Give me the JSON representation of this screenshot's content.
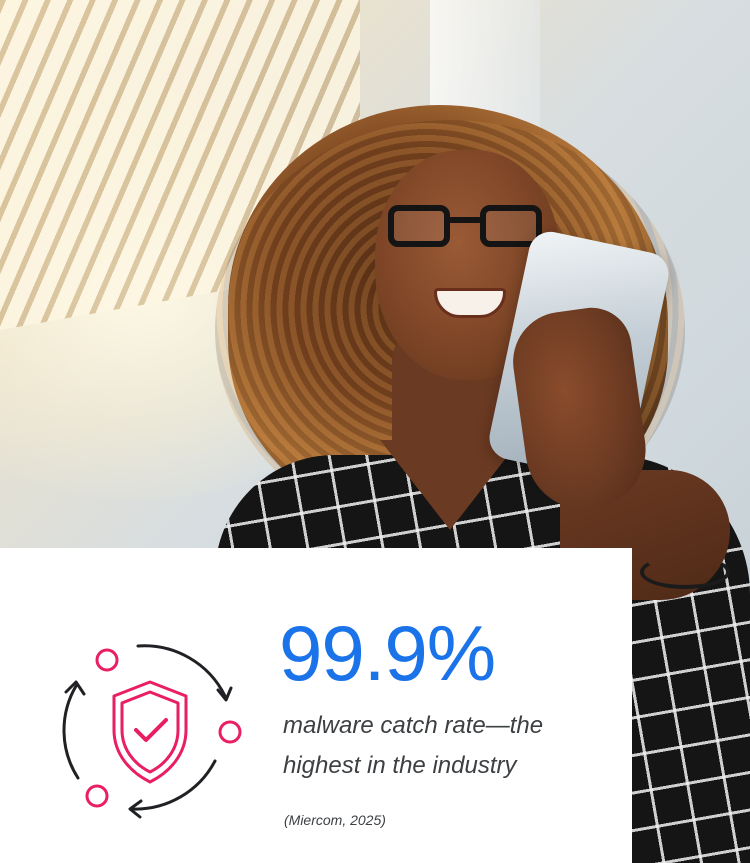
{
  "hero": {
    "image": "Smiling woman with curly hair and glasses looking at a smartphone"
  },
  "stat": {
    "value": "99.9%",
    "description": "malware catch rate—the highest in the industry",
    "source": "(Miercom, 2025)"
  },
  "icon": {
    "name": "shield-check-cycle-icon",
    "accent_color": "#e91e63",
    "line_color": "#202124"
  },
  "colors": {
    "stat": "#1a73e8",
    "text": "#3c4043",
    "card": "#ffffff"
  }
}
